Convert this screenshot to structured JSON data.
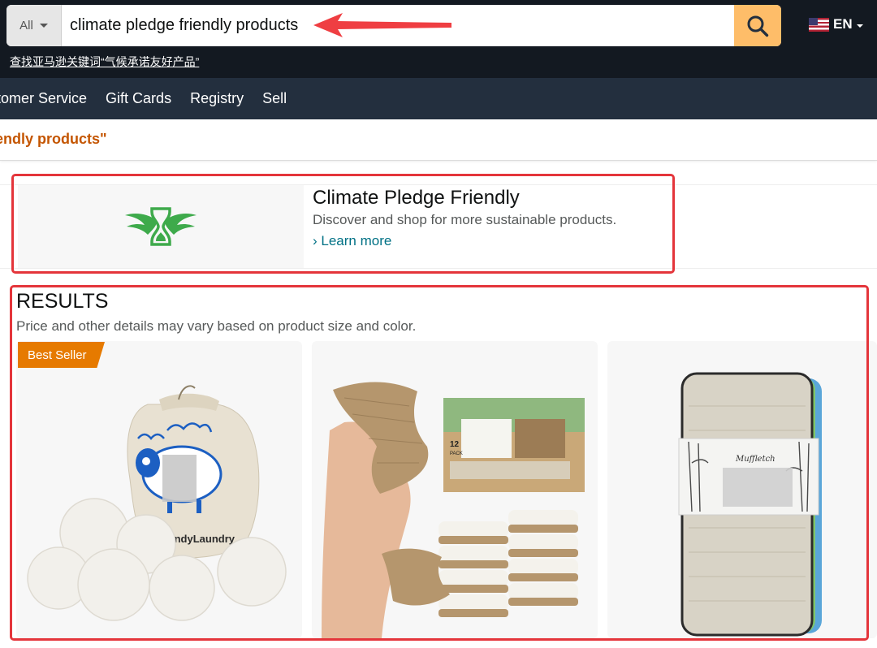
{
  "header": {
    "search_category": "All",
    "search_query": "climate pledge friendly products",
    "language": "EN",
    "helper_link": "查找亚马逊关键词“气候承诺友好产品”"
  },
  "nav": {
    "items": [
      "stomer Service",
      "Gift Cards",
      "Registry",
      "Sell"
    ]
  },
  "query_line": "endly products\"",
  "promo": {
    "title": "Climate Pledge Friendly",
    "subtitle": "Discover and shop for more sustainable products.",
    "link": "› Learn more"
  },
  "results": {
    "title": "RESULTS",
    "subtitle": "Price and other details may vary based on product size and color.",
    "badge": "Best Seller",
    "products": [
      {
        "image": "wool-dryer-balls-with-bag",
        "brand_on_bag": "HandyLaundry"
      },
      {
        "image": "natural-sponges-pack",
        "pack_count": "12",
        "pack_word": "PACK"
      },
      {
        "image": "rolled-bamboo-towels",
        "brand_on_band": "Muffletch"
      }
    ]
  },
  "colors": {
    "topbar": "#131921",
    "navbar": "#232f3e",
    "search_button": "#febd69",
    "link": "#007185",
    "query_text": "#c45500",
    "badge": "#e67a00",
    "highlight_box": "#e4353b",
    "arrow": "#ef3e42",
    "logo_green": "#3eaa4b"
  }
}
